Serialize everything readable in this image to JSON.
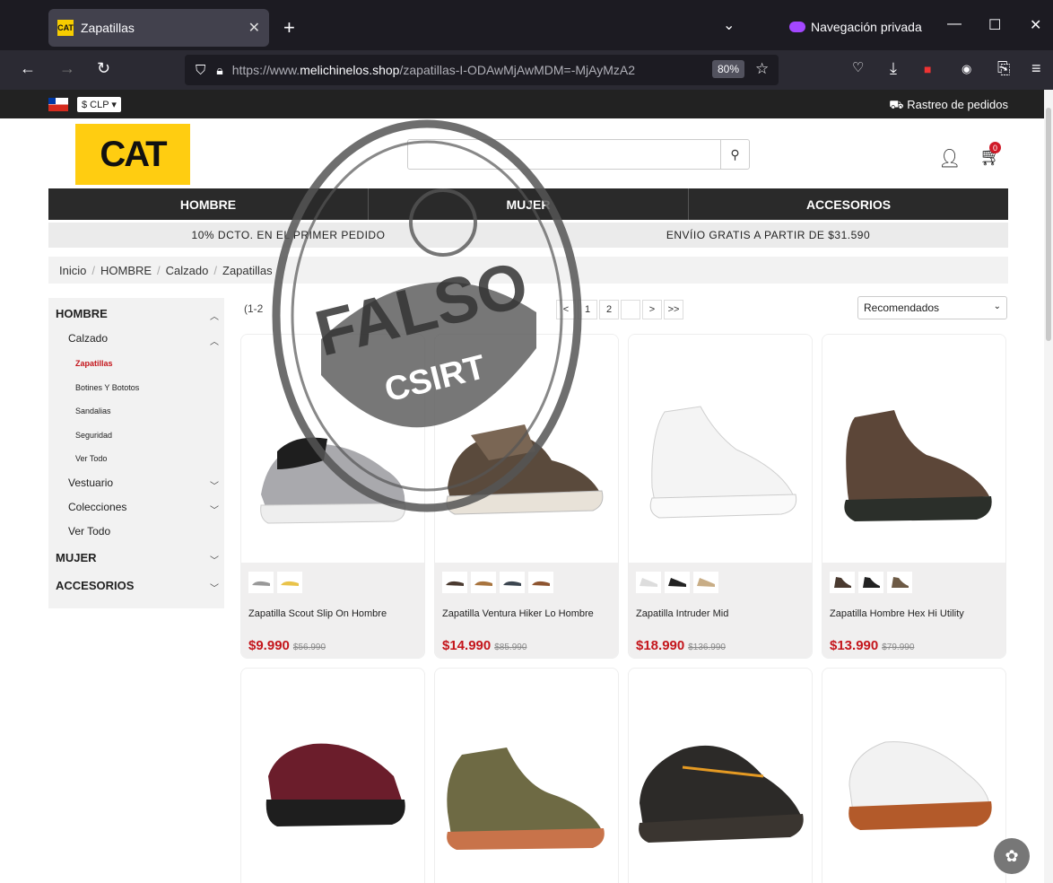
{
  "browser": {
    "tab_title": "Zapatillas",
    "tab_favicon": "CAT",
    "new_tab": "+",
    "private_label": "Navegación privada",
    "url_prefix": "https://www.",
    "url_host": "melichinelos.shop",
    "url_path": "/zapatillas-I-ODAwMjAwMDM=-MjAyMzA2",
    "zoom": "80%"
  },
  "topbar": {
    "currency": "$ CLP ▾",
    "tracking": "⛟ Rastreo de pedidos"
  },
  "header": {
    "logo": "CAT",
    "cart_count": "0"
  },
  "nav": [
    "HOMBRE",
    "MUJER",
    "ACCESORIOS"
  ],
  "promo": [
    "10% DCTO. EN EL PRIMER PEDIDO",
    "ENVÍIO GRATIS A PARTIR DE $31.590"
  ],
  "breadcrumb": [
    "Inicio",
    "HOMBRE",
    "Calzado",
    "Zapatillas"
  ],
  "sidebar": {
    "hombre": "HOMBRE",
    "calzado": "Calzado",
    "items": [
      "Zapatillas",
      "Botines Y Bototos",
      "Sandalias",
      "Seguridad",
      "Ver Todo"
    ],
    "vestuario": "Vestuario",
    "colecciones": "Colecciones",
    "ver_todo": "Ver Todo",
    "mujer": "MUJER",
    "accesorios": "ACCESORIOS"
  },
  "listing": {
    "count": "(1-2",
    "pages": [
      "<",
      "1",
      "2",
      "",
      ">",
      ">>"
    ],
    "sort": "Recomendados"
  },
  "products": [
    {
      "name": "Zapatilla Scout Slip On Hombre",
      "price": "$9.990",
      "old": "$56.990"
    },
    {
      "name": "Zapatilla Ventura Hiker Lo Hombre",
      "price": "$14.990",
      "old": "$85.990"
    },
    {
      "name": "Zapatilla Intruder Mid",
      "price": "$18.990",
      "old": "$136.990"
    },
    {
      "name": "Zapatilla Hombre Hex Hi Utility",
      "price": "$13.990",
      "old": "$79.990"
    }
  ],
  "stamp": {
    "word": "FALSO",
    "org": "CSIRT"
  },
  "colors": {
    "accent": "#c4161c",
    "brand_yellow": "#ffcd11",
    "dark": "#2a2a2a"
  }
}
